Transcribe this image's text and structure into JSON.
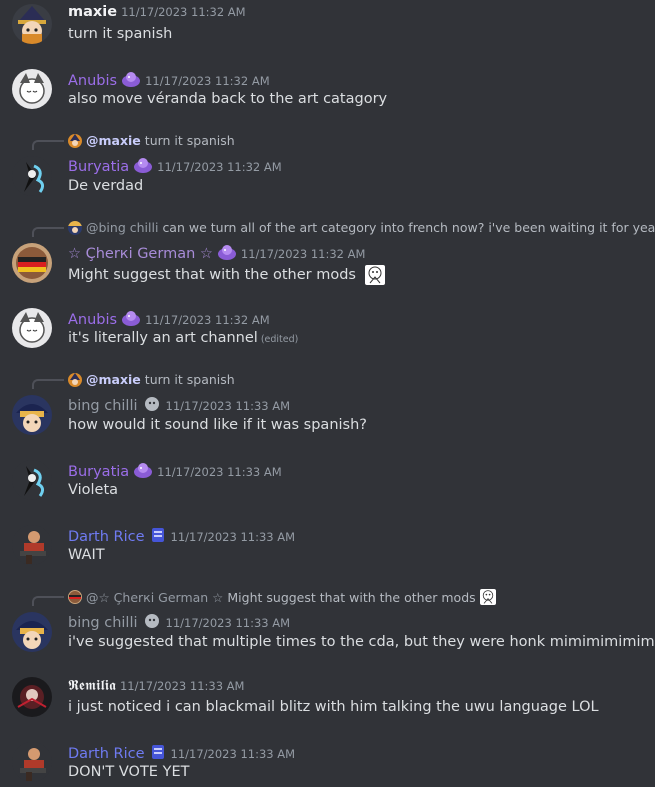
{
  "messages": [
    {
      "author": "maxie",
      "time": "11/17/2023 11:32 AM",
      "text": "turn it spanish"
    },
    {
      "author": "Anubis",
      "time": "11/17/2023 11:32 AM",
      "text": "also move véranda back to the art catagory"
    },
    {
      "reply_mention": "@maxie",
      "reply_text": "turn it spanish",
      "author": "Buryatia",
      "time": "11/17/2023 11:32 AM",
      "text": "De verdad"
    },
    {
      "reply_mention": "@bing chilli",
      "reply_text": "can we turn all of the art category into french now? i've been waiting it for years",
      "author": "☆ Çherкi German ☆",
      "time": "11/17/2023 11:32 AM",
      "text": "Might suggest that with the other mods"
    },
    {
      "author": "Anubis",
      "time": "11/17/2023 11:32 AM",
      "text": "it's literally an art channel",
      "edited": "(edited)"
    },
    {
      "reply_mention": "@maxie",
      "reply_text": "turn it spanish",
      "author": "bing chilli",
      "time": "11/17/2023 11:33 AM",
      "text": "how would it sound like if it was spanish?"
    },
    {
      "author": "Buryatia",
      "time": "11/17/2023 11:33 AM",
      "text": "Violeta"
    },
    {
      "author": "Darth Rice",
      "time": "11/17/2023 11:33 AM",
      "text": "WAIT"
    },
    {
      "reply_mention": "@☆ Çherкi German ☆",
      "reply_text": "Might suggest that with the other mods",
      "author": "bing chilli",
      "time": "11/17/2023 11:33 AM",
      "text": "i've suggested that multiple times to the cda, but they were honk mimimimimimimi"
    },
    {
      "author": "𝕽𝖊𝖒𝖎𝖑𝖎𝖆",
      "time": "11/17/2023 11:33 AM",
      "text": "i just noticed i can blackmail blitz with him talking the uwu language LOL"
    },
    {
      "author": "Darth Rice",
      "time": "11/17/2023 11:33 AM",
      "text": "DON'T VOTE YET"
    }
  ],
  "colors": {
    "background": "#313338",
    "name_purple": "#9b6ee8",
    "name_blue": "#6f7bf2",
    "timestamp": "#949ba4"
  }
}
